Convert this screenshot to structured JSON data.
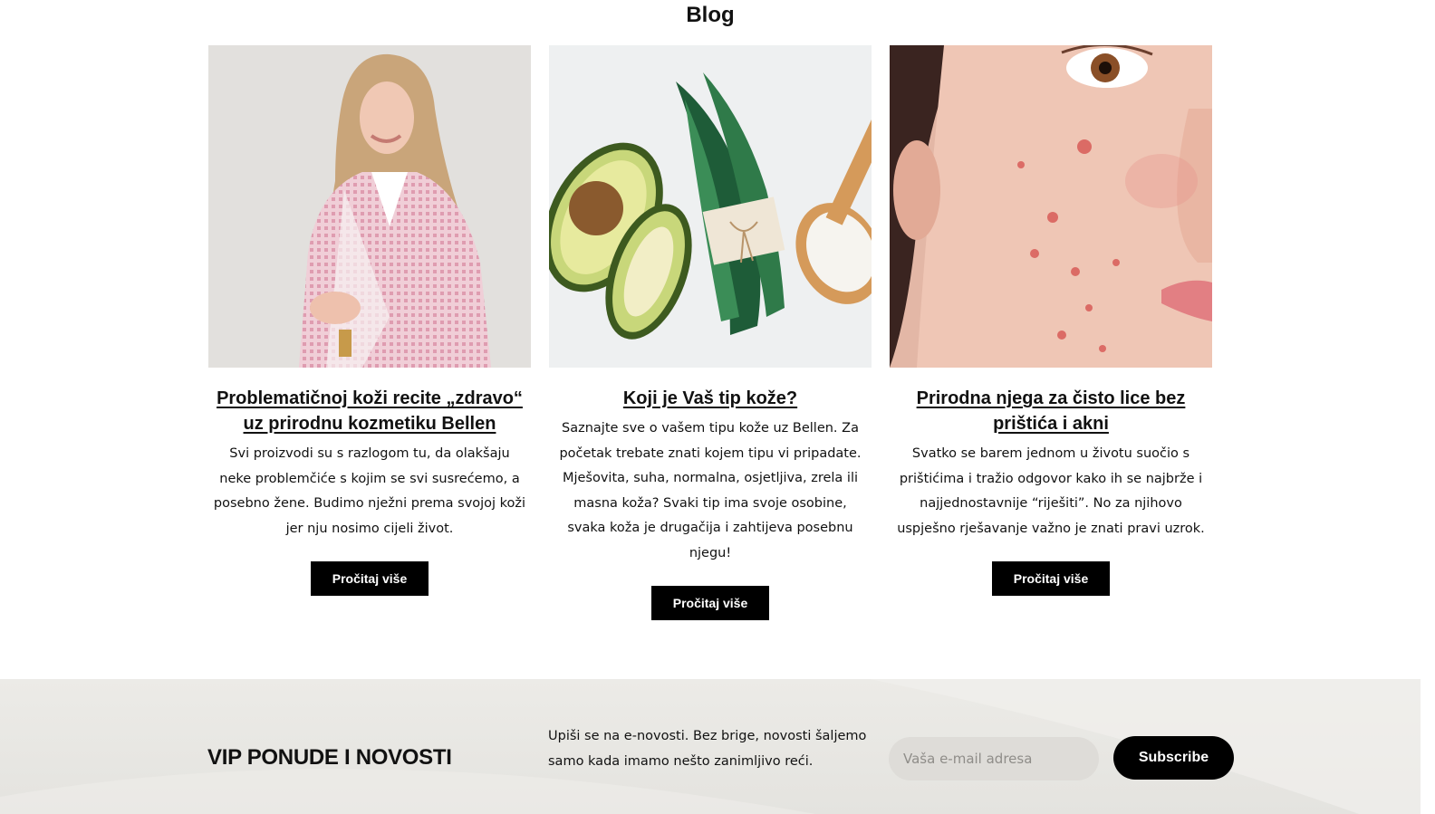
{
  "blog": {
    "title": "Blog",
    "posts": [
      {
        "title": "Problematičnoj koži recite „zdravo“ uz prirodnu kozmetiku Bellen",
        "excerpt": "Svi proizvodi su s razlogom tu, da olakšaju neke problemčiće s kojim se svi susrećemo, a posebno žene. Budimo nježni prema svojoj koži jer nju nosimo cijeli život.",
        "button": "Pročitaj više",
        "image": "woman-pink-houndstooth-jacket-photo"
      },
      {
        "title": "Koji je Vaš tip kože?",
        "excerpt": "Saznajte sve o vašem tipu kože uz Bellen. Za početak trebate znati kojem tipu vi pripadate. Mješovita, suha, normalna, osjetljiva, zrela ili masna koža? Svaki tip ima svoje osobine, svaka koža je drugačija i zahtijeva posebnu njegu!",
        "button": "Pročitaj više",
        "image": "avocado-aloe-salt-photo"
      },
      {
        "title": "Prirodna njega za čisto lice bez prištića i akni",
        "excerpt": "Svatko se barem jednom u životu suočio s prištićima i tražio odgovor kako ih se najbrže i najjednostavnije “riješiti”. No za njihovo uspješno rješavanje važno je znati pravi uzrok.",
        "button": "Pročitaj više",
        "image": "face-with-acne-photo"
      }
    ]
  },
  "newsletter": {
    "title": "VIP PONUDE I NOVOSTI",
    "description": "Upiši se na e-novosti. Bez brige, novosti šaljemo samo kada imamo nešto zanimljivo reći.",
    "email_placeholder": "Vaša e-mail adresa",
    "subscribe_label": "Subscribe"
  },
  "colors": {
    "button_bg": "#000000",
    "footer_bg": "#e8e7e3",
    "input_bg": "#dedcd8"
  }
}
